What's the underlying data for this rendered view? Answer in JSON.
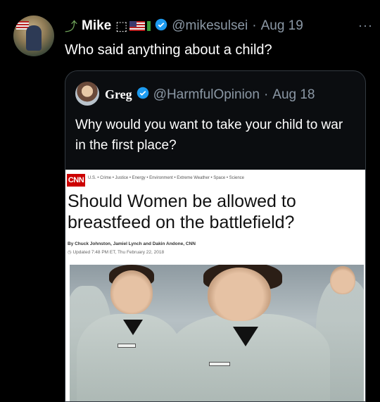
{
  "tweet": {
    "name": "Mike",
    "name_emojis": "↪ ⩟",
    "handle": "@mikesulsei",
    "date": "Aug 19",
    "more": "···",
    "text": "Who said anything about a child?"
  },
  "quote": {
    "name": "Greg",
    "handle": "@HarmfulOpinion",
    "date": "Aug 18",
    "text": "Why would you want to take your child to war in the first place?"
  },
  "article": {
    "logo": "CNN",
    "nav": "U.S. • Crime • Justice • Energy • Environment • Extreme Weather • Space • Science",
    "headline": "Should Women be allowed to breastfeed on the battlefield?",
    "byline": "By Chuck Johnston, Jamiel Lynch and Dakin Andone, CNN",
    "updated": "Updated 7:48 PM ET, Thu February 22, 2018"
  },
  "colors": {
    "verified": "#1d9bf0",
    "cnn_red": "#cc0000",
    "muted": "#8b98a5"
  }
}
